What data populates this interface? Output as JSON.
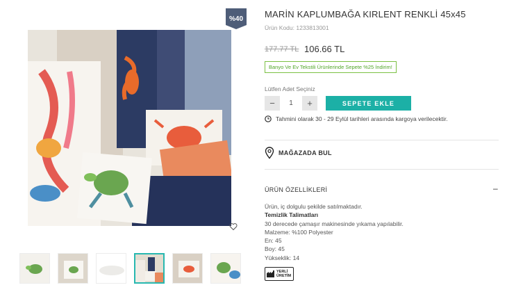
{
  "product": {
    "title": "MARİN KAPLUMBAĞA KIRLENT RENKLİ 45x45",
    "code": "Ürün Kodu: 1233813001",
    "old_price": "177.77 TL",
    "new_price": "106.66 TL",
    "discount_badge": "%40",
    "promo": "Banyo Ve Ev Tekstili Ürünlerinde Sepete %25 İndirim!"
  },
  "purchase": {
    "qty_label": "Lütfen Adet Seçiniz",
    "minus": "−",
    "qty_value": "1",
    "plus": "+",
    "add_to_cart": "SEPETE EKLE",
    "shipping": "Tahmini olarak 30 - 29 Eylül tarihleri arasında kargoya verilecektir."
  },
  "store": {
    "label": "MAĞAZADA BUL"
  },
  "features": {
    "heading": "ÜRÜN ÖZELLİKLERİ",
    "toggle": "–",
    "lines": {
      "desc": "Ürün, iç dolgulu şekilde satılmaktadır.",
      "care_title": "Temizlik Talimatları",
      "care": "30 derecede çamaşır makinesinde yıkama yapılabilir.",
      "material": "Malzeme: %100 Polyester",
      "width": "En: 45",
      "length": "Boy: 45",
      "height": "Yükseklik: 14"
    }
  },
  "badge": {
    "line1": "YERLİ",
    "line2": "ÜRETİM"
  },
  "gallery": {
    "thumbnails": [
      "thumb-1",
      "thumb-2",
      "thumb-3",
      "thumb-4",
      "thumb-5",
      "thumb-6"
    ],
    "active_index": 3
  },
  "colors": {
    "accent": "#1cb0a6",
    "badge": "#4e5d78",
    "promo": "#7bc043"
  }
}
